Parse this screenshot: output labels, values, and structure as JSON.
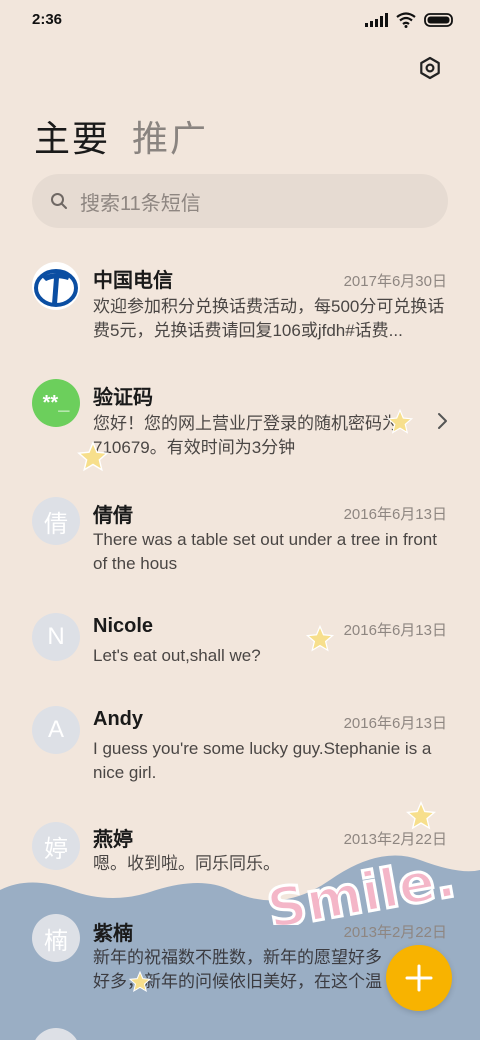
{
  "status_bar": {
    "time": "2:36"
  },
  "tabs": [
    {
      "label": "主要",
      "active": true
    },
    {
      "label": "推广",
      "active": false
    }
  ],
  "search": {
    "placeholder": "搜索11条短信"
  },
  "messages": [
    {
      "name": "中国电信",
      "date": "2017年6月30日",
      "preview": "欢迎参加积分兑换话费活动，每500分可兑换话费5元，兑换话费请回复106或jfdh#话费...",
      "avatar": "telecom-logo"
    },
    {
      "name": "验证码",
      "date": "",
      "preview": "您好！您的网上营业厅登录的随机密码为：710679。有效时间为3分钟",
      "avatar_text": "**_"
    },
    {
      "name": "倩倩",
      "date": "2016年6月13日",
      "preview": "There was a table set out under a tree in front of the hous",
      "avatar_text": "倩"
    },
    {
      "name": "Nicole",
      "date": "2016年6月13日",
      "preview": "Let's eat out,shall we?",
      "avatar_text": "N"
    },
    {
      "name": "Andy",
      "date": "2016年6月13日",
      "preview": "I guess you're some lucky guy.Stephanie is a nice girl.",
      "avatar_text": "A"
    },
    {
      "name": "燕婷",
      "date": "2013年2月22日",
      "preview": "嗯。收到啦。同乐同乐。",
      "avatar_text": "婷"
    },
    {
      "name": "紫楠",
      "date": "2013年2月22日",
      "preview": "新年的祝福数不胜数，新年的愿望好多好多，新年的问候依旧美好，在这个温馨的时刻",
      "avatar_text": "楠"
    }
  ],
  "decor": {
    "wallpaper_text": "Smile."
  },
  "colors": {
    "background": "#f2e6dc",
    "fab": "#f8b300",
    "wave": "#9aaec4"
  }
}
